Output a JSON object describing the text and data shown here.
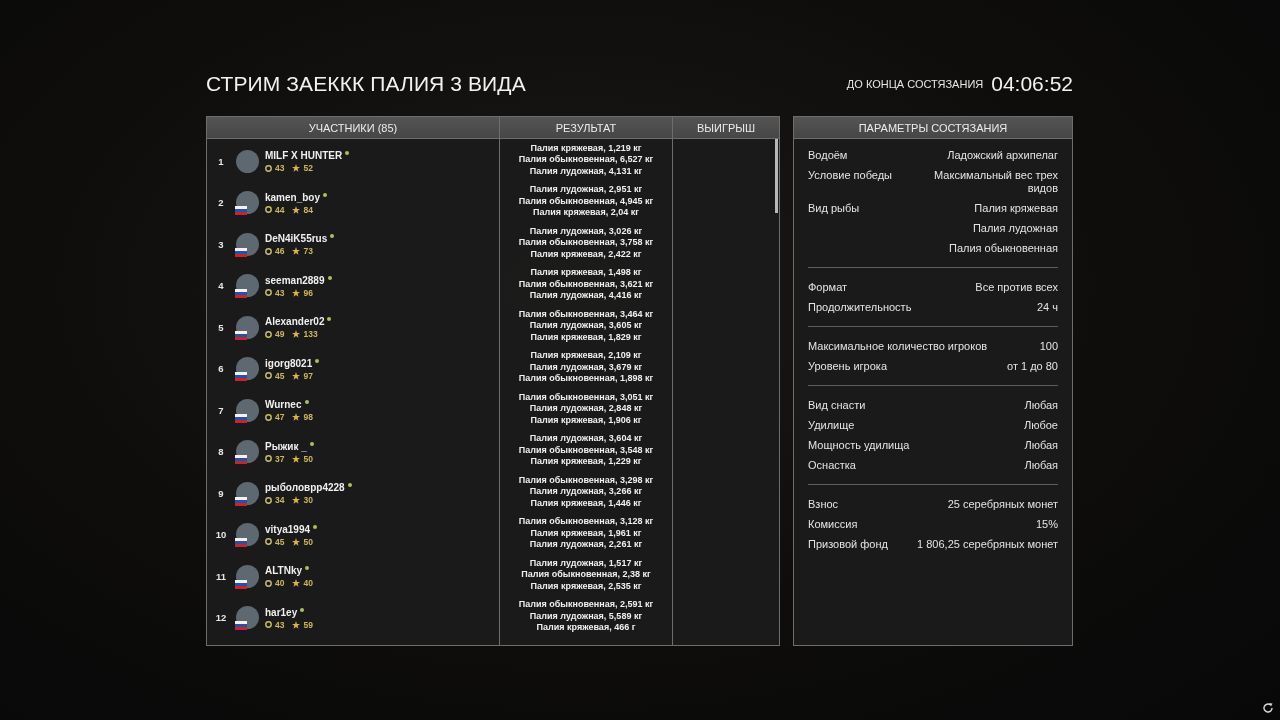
{
  "header": {
    "title": "СТРИМ ЗАЕККК ПАЛИЯ 3 ВИДА",
    "timer_label": "ДО КОНЦА СОСТЯЗАНИЯ",
    "timer": "04:06:52"
  },
  "participants_table": {
    "columns": [
      "УЧАСТНИКИ (85)",
      "РЕЗУЛЬТАТ",
      "ВЫИГРЫШ"
    ],
    "rows": [
      {
        "rank": "1",
        "name": "MILF X HUNTER",
        "online": true,
        "country_flag": false,
        "circle_value": "43",
        "star_value": "52",
        "result": [
          "Палия кряжевая, 1,219 кг",
          "Палия обыкновенная, 6,527 кг",
          "Палия лудожная, 4,131 кг"
        ]
      },
      {
        "rank": "2",
        "name": "kamen_boy",
        "online": true,
        "country_flag": true,
        "circle_value": "44",
        "star_value": "84",
        "result": [
          "Палия лудожная, 2,951 кг",
          "Палия обыкновенная, 4,945 кг",
          "Палия кряжевая, 2,04 кг"
        ]
      },
      {
        "rank": "3",
        "name": "DeN4iK55rus",
        "online": true,
        "country_flag": true,
        "circle_value": "46",
        "star_value": "73",
        "result": [
          "Палия лудожная, 3,026 кг",
          "Палия обыкновенная, 3,758 кг",
          "Палия кряжевая, 2,422 кг"
        ]
      },
      {
        "rank": "4",
        "name": "seeman2889",
        "online": true,
        "country_flag": true,
        "circle_value": "43",
        "star_value": "96",
        "result": [
          "Палия кряжевая, 1,498 кг",
          "Палия обыкновенная, 3,621 кг",
          "Палия лудожная, 4,416 кг"
        ]
      },
      {
        "rank": "5",
        "name": "Alexander02",
        "online": true,
        "country_flag": true,
        "circle_value": "49",
        "star_value": "133",
        "result": [
          "Палия обыкновенная, 3,464 кг",
          "Палия лудожная, 3,605 кг",
          "Палия кряжевая, 1,829 кг"
        ]
      },
      {
        "rank": "6",
        "name": "igorg8021",
        "online": true,
        "country_flag": true,
        "circle_value": "45",
        "star_value": "97",
        "result": [
          "Палия кряжевая, 2,109 кг",
          "Палия лудожная, 3,679 кг",
          "Палия обыкновенная, 1,898 кг"
        ]
      },
      {
        "rank": "7",
        "name": "Wurnec",
        "online": true,
        "country_flag": true,
        "circle_value": "47",
        "star_value": "98",
        "result": [
          "Палия обыкновенная, 3,051 кг",
          "Палия лудожная, 2,848 кг",
          "Палия кряжевая, 1,906 кг"
        ]
      },
      {
        "rank": "8",
        "name": "Рыжик _",
        "online": true,
        "country_flag": true,
        "circle_value": "37",
        "star_value": "50",
        "result": [
          "Палия лудожная, 3,604 кг",
          "Палия обыкновенная, 3,548 кг",
          "Палия кряжевая, 1,229 кг"
        ]
      },
      {
        "rank": "9",
        "name": "рыболоврр4228",
        "online": true,
        "country_flag": true,
        "circle_value": "34",
        "star_value": "30",
        "result": [
          "Палия обыкновенная, 3,298 кг",
          "Палия лудожная, 3,266 кг",
          "Палия кряжевая, 1,446 кг"
        ]
      },
      {
        "rank": "10",
        "name": "vitya1994",
        "online": true,
        "country_flag": true,
        "circle_value": "45",
        "star_value": "50",
        "result": [
          "Палия обыкновенная, 3,128 кг",
          "Палия кряжевая, 1,961 кг",
          "Палия лудожная, 2,261 кг"
        ]
      },
      {
        "rank": "11",
        "name": "ALTNky",
        "online": true,
        "country_flag": true,
        "circle_value": "40",
        "star_value": "40",
        "result": [
          "Палия лудожная, 1,517 кг",
          "Палия обыкновенная, 2,38 кг",
          "Палия кряжевая, 2,535 кг"
        ]
      },
      {
        "rank": "12",
        "name": "har1ey",
        "online": true,
        "country_flag": true,
        "circle_value": "43",
        "star_value": "59",
        "result": [
          "Палия обыкновенная, 2,591 кг",
          "Палия лудожная, 5,589 кг",
          "Палия кряжевая, 466 г"
        ]
      }
    ]
  },
  "parameters_panel": {
    "title": "ПАРАМЕТРЫ СОСТЯЗАНИЯ",
    "groups": [
      {
        "rows": [
          {
            "label": "Водоём",
            "values": [
              "Ладожский архипелаг"
            ]
          },
          {
            "label": "Условие победы",
            "values": [
              "Максимальный вес трех видов"
            ]
          },
          {
            "label": "Вид рыбы",
            "values": [
              "Палия кряжевая",
              "Палия лудожная",
              "Палия обыкновенная"
            ]
          }
        ]
      },
      {
        "rows": [
          {
            "label": "Формат",
            "values": [
              "Все против всех"
            ]
          },
          {
            "label": "Продолжительность",
            "values": [
              "24 ч"
            ]
          }
        ]
      },
      {
        "rows": [
          {
            "label": "Максимальное количество игроков",
            "values": [
              "100"
            ]
          },
          {
            "label": "Уровень игрока",
            "values": [
              "от 1 до 80"
            ]
          }
        ]
      },
      {
        "rows": [
          {
            "label": "Вид снасти",
            "values": [
              "Любая"
            ]
          },
          {
            "label": "Удилище",
            "values": [
              "Любое"
            ]
          },
          {
            "label": "Мощность удилища",
            "values": [
              "Любая"
            ]
          },
          {
            "label": "Оснастка",
            "values": [
              "Любая"
            ]
          }
        ]
      },
      {
        "rows": [
          {
            "label": "Взнос",
            "values": [
              "25 серебряных монет"
            ]
          },
          {
            "label": "Комиссия",
            "values": [
              "15%"
            ]
          },
          {
            "label": "Призовой фонд",
            "values": [
              "1 806,25 серебряных монет"
            ]
          }
        ]
      }
    ]
  }
}
